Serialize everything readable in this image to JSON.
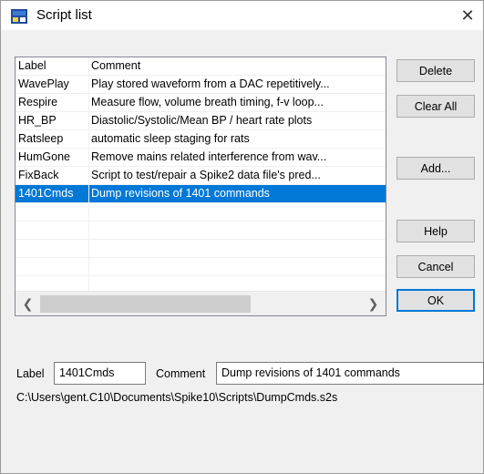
{
  "window": {
    "title": "Script list"
  },
  "list": {
    "headers": [
      "Label",
      "Comment"
    ],
    "rows": [
      {
        "label": "WavePlay",
        "comment": "Play stored waveform from a DAC repetitively..."
      },
      {
        "label": "Respire",
        "comment": "Measure flow, volume breath timing, f-v loop..."
      },
      {
        "label": "HR_BP",
        "comment": "Diastolic/Systolic/Mean BP / heart rate plots"
      },
      {
        "label": "Ratsleep",
        "comment": "automatic sleep staging for rats"
      },
      {
        "label": "HumGone",
        "comment": "Remove mains related interference from wav..."
      },
      {
        "label": "FixBack",
        "comment": "Script to test/repair a Spike2 data file's pred..."
      },
      {
        "label": "1401Cmds",
        "comment": "Dump revisions of 1401 commands"
      }
    ],
    "selected_index": 6
  },
  "buttons": {
    "delete": "Delete",
    "clear_all": "Clear All",
    "add": "Add...",
    "help": "Help",
    "cancel": "Cancel",
    "ok": "OK"
  },
  "form": {
    "label_caption": "Label",
    "label_value": "1401Cmds",
    "comment_caption": "Comment",
    "comment_value": "Dump revisions of 1401 commands"
  },
  "path": "C:\\Users\\gent.C10\\Documents\\Spike10\\Scripts\\DumpCmds.s2s"
}
